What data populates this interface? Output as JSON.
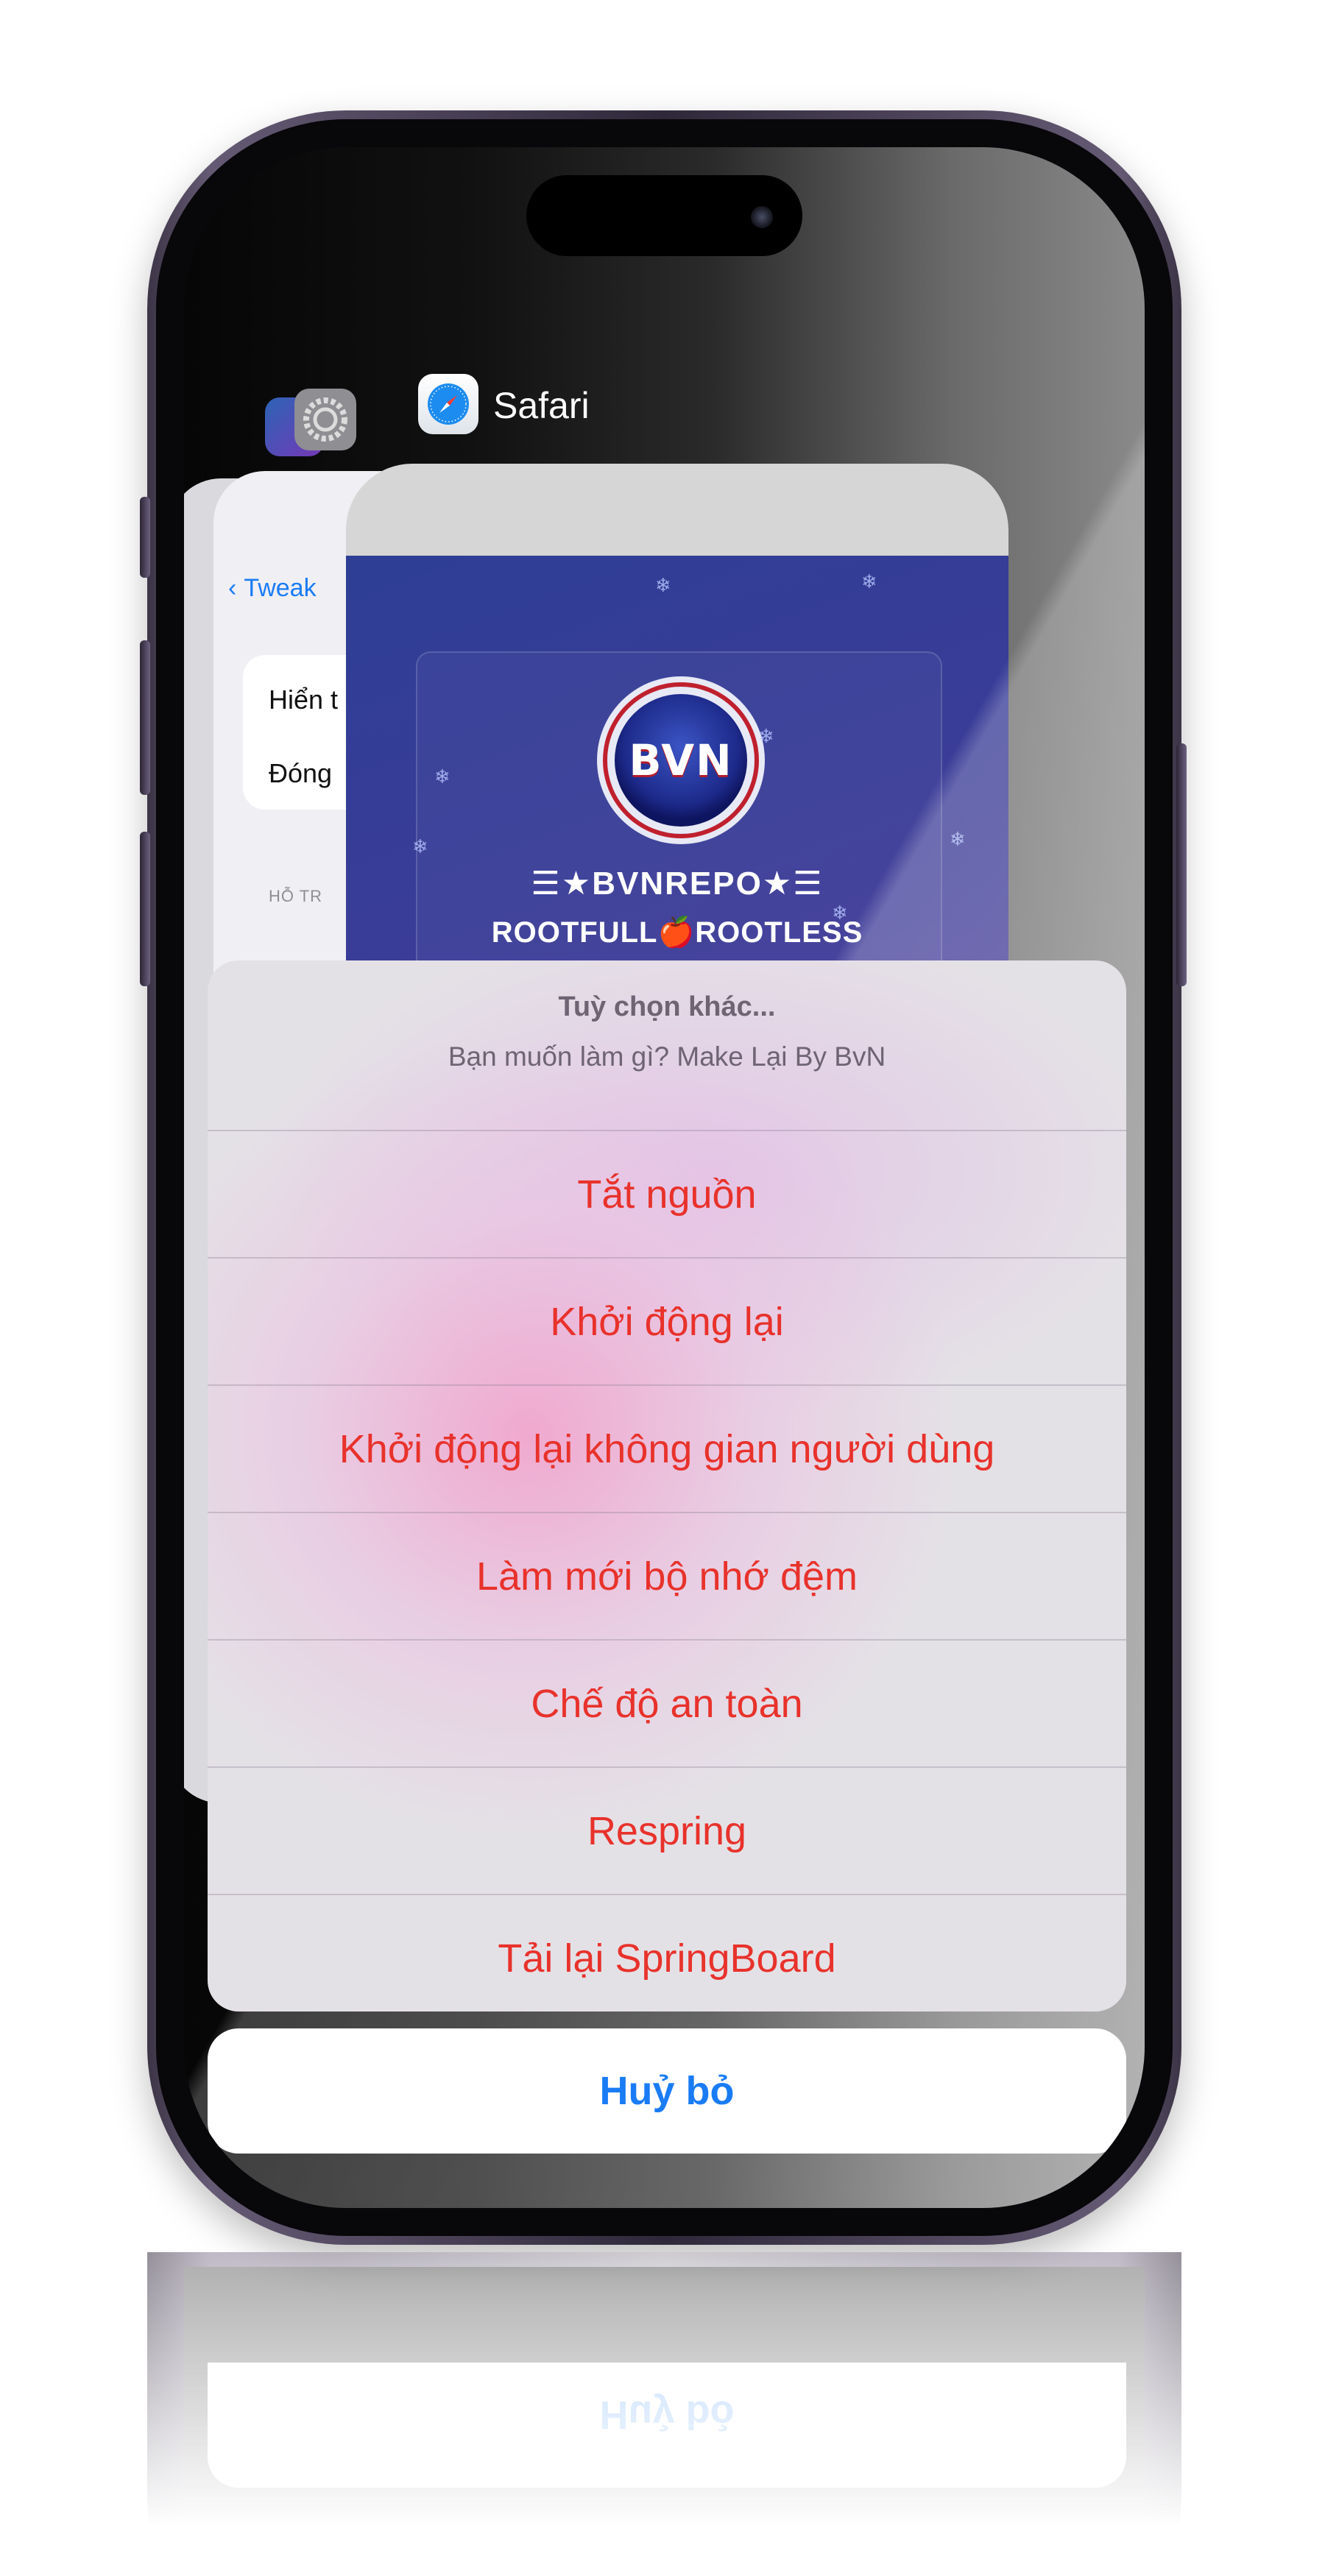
{
  "switcher": {
    "app_name": "Safari",
    "back_card": {
      "nav_back": "Tweak",
      "row1": "Hiển t",
      "row2": "Đóng",
      "section": "HỖ TR"
    },
    "front_card": {
      "logo_text": "BVN",
      "banner_line1": "☰★BVNREPO★☰",
      "banner_line2": "ROOTFULL🍎ROOTLESS"
    }
  },
  "action_sheet": {
    "title": "Tuỳ chọn khác...",
    "message": "Bạn muốn làm gì? Make Lại By BvN",
    "items": [
      "Tắt nguồn",
      "Khởi động lại",
      "Khởi động lại không gian người dùng",
      "Làm mới bộ nhớ đệm",
      "Chế độ an toàn",
      "Respring",
      "Tải lại SpringBoard"
    ],
    "cancel": "Huỷ bỏ"
  },
  "colors": {
    "destructive": "#e8322b",
    "accent": "#1a7cf5"
  }
}
